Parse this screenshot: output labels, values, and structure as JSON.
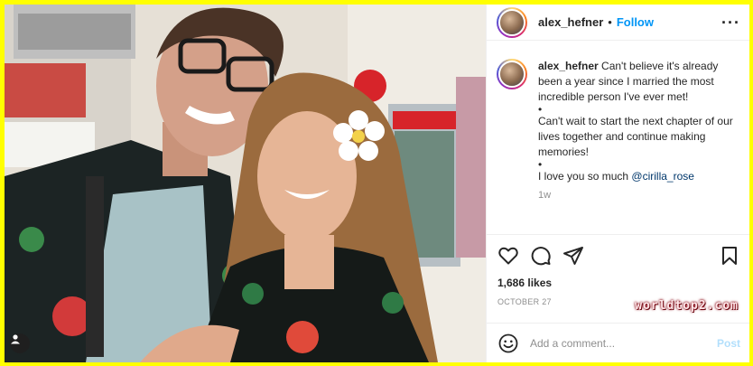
{
  "header": {
    "username": "alex_hefner",
    "separator": "•",
    "follow_label": "Follow",
    "more_icon": "more-horizontal-icon"
  },
  "caption": {
    "username": "alex_hefner",
    "line1": "Can't believe it's already been a year since I married the most incredible person I've ever met!",
    "bullet1": "•",
    "line2": "Can't wait to start the next chapter of our lives together and continue making memories!",
    "bullet2": "•",
    "line3_prefix": "I love you so much ",
    "mention": "@cirilla_rose",
    "time": "1w"
  },
  "actions": {
    "icons": [
      "heart-icon",
      "comment-icon",
      "share-icon",
      "bookmark-icon"
    ],
    "likes": "1,686 likes",
    "date": "OCTOBER 27"
  },
  "comment_box": {
    "placeholder": "Add a comment...",
    "post_label": "Post"
  },
  "watermark": "worldtop2.com",
  "colors": {
    "frame": "#ffff00",
    "follow": "#0095f6",
    "post_disabled": "#b2dffc",
    "secondary_text": "#8e8e8e"
  }
}
